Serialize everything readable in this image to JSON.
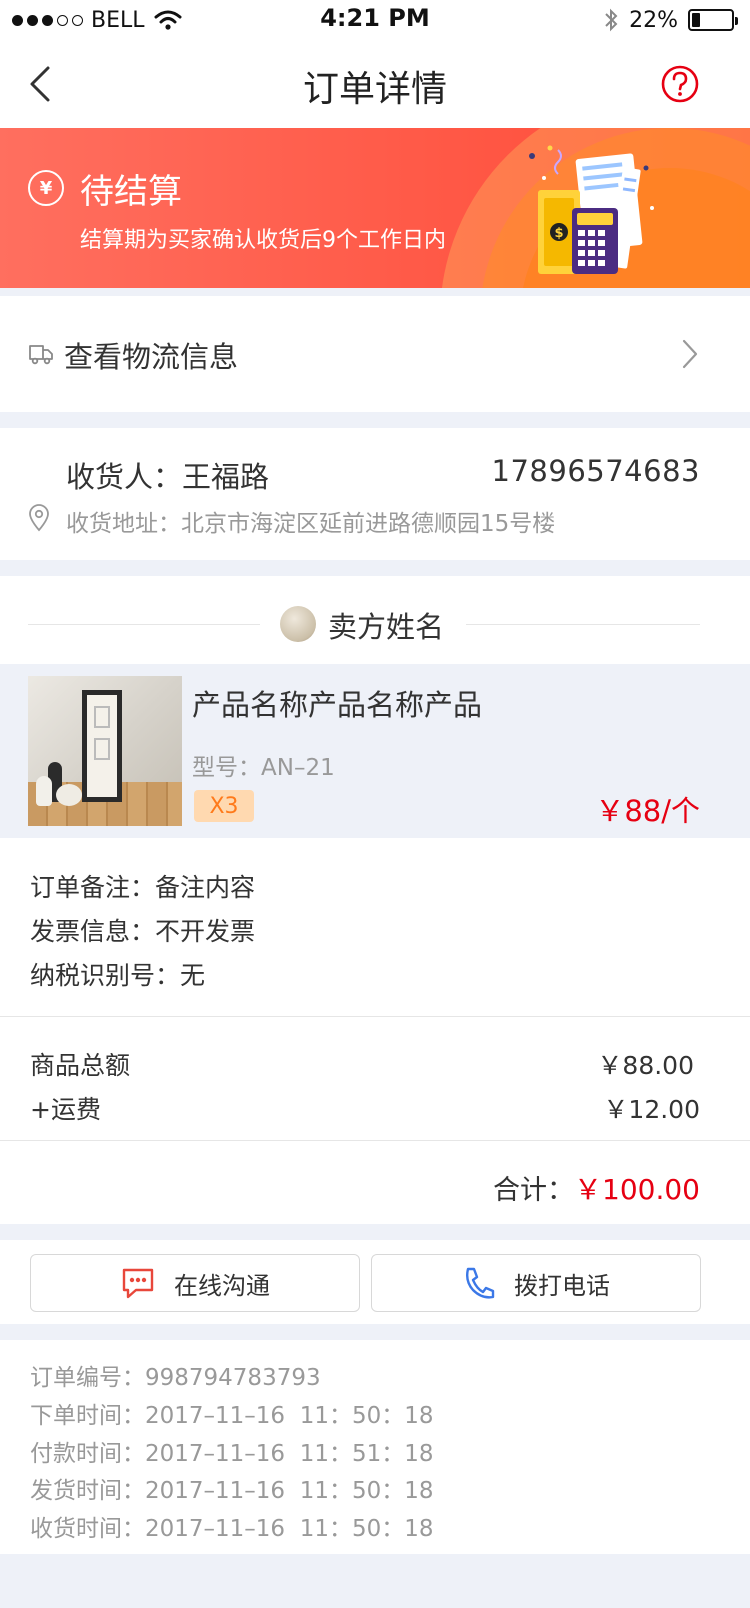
{
  "status_bar": {
    "carrier": "BELL",
    "time": "4:21 PM",
    "battery": "22%",
    "battery_level": 0.22
  },
  "nav": {
    "title": "订单详情",
    "back_icon": "chevron-left-icon",
    "help_icon": "question-circle-icon",
    "accent": "#e60012"
  },
  "banner": {
    "status_title": "待结算",
    "status_desc": "结算期为买家确认收货后9个工作日内",
    "icon": "yen-circle-icon"
  },
  "logistics": {
    "label": "查看物流信息",
    "icon": "truck-icon"
  },
  "receiver": {
    "name_label": "收货人：",
    "name": "王福路",
    "phone": "17896574683",
    "address_label": "收货地址：",
    "address": "北京市海淀区延前进路德顺园15号楼"
  },
  "seller": {
    "name": "卖方姓名"
  },
  "product": {
    "name": "产品名称产品名称产品",
    "model_label": "型号：",
    "model": "AN–21",
    "quantity": "X3",
    "price": "￥88/个"
  },
  "order_info": {
    "remark_label": "订单备注：",
    "remark": "备注内容",
    "invoice_label": "发票信息：",
    "invoice": "不开发票",
    "tax_label": "纳税识别号：",
    "tax": "无"
  },
  "amounts": {
    "goods_label": "商品总额",
    "goods_value": "￥88.00",
    "freight_label": "+运费",
    "freight_value": "￥12.00",
    "total_label": "合计：",
    "total_value": "￥100.00"
  },
  "actions": {
    "chat_label": "在线沟通",
    "call_label": "拨打电话"
  },
  "timeline": {
    "order_no_label": "订单编号：",
    "order_no": "998794783793",
    "created_label": "下单时间：",
    "created": "2017–11–16  11：50：18",
    "paid_label": "付款时间：",
    "paid": "2017–11–16  11：51：18",
    "shipped_label": "发货时间：",
    "shipped": "2017–11–16  11：50：18",
    "received_label": "收货时间：",
    "received": "2017–11–16  11：50：18"
  }
}
